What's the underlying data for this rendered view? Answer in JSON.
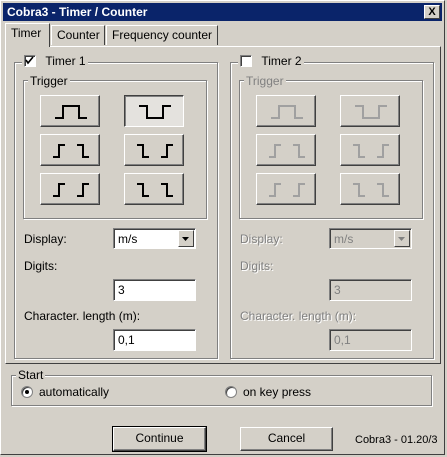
{
  "window": {
    "title": "Cobra3 - Timer / Counter",
    "close_label": "X"
  },
  "tabs": [
    {
      "label": "Timer"
    },
    {
      "label": "Counter"
    },
    {
      "label": "Frequency counter"
    }
  ],
  "timer1": {
    "label": "Timer 1",
    "checked": true,
    "trigger_title": "Trigger",
    "display_label": "Display:",
    "display_value": "m/s",
    "digits_label": "Digits:",
    "digits_value": "3",
    "charlen_label": "Character. length (m):",
    "charlen_value": "0,1"
  },
  "timer2": {
    "label": "Timer 2",
    "checked": false,
    "trigger_title": "Trigger",
    "display_label": "Display:",
    "display_value": "m/s",
    "digits_label": "Digits:",
    "digits_value": "3",
    "charlen_label": "Character. length (m):",
    "charlen_value": "0,1"
  },
  "trigger_buttons": [
    {
      "icon": "pulse-high-icon",
      "pressed": false
    },
    {
      "icon": "pulse-low-icon",
      "pressed": true
    },
    {
      "icon": "rising-falling-icon",
      "pressed": false
    },
    {
      "icon": "falling-rising-icon",
      "pressed": false
    },
    {
      "icon": "rising-rising-icon",
      "pressed": false
    },
    {
      "icon": "falling-falling-icon",
      "pressed": false
    }
  ],
  "start": {
    "title": "Start",
    "options": [
      {
        "label": "automatically",
        "selected": true
      },
      {
        "label": "on key press",
        "selected": false
      }
    ]
  },
  "buttons": {
    "continue": "Continue",
    "cancel": "Cancel"
  },
  "version": "Cobra3 - 01.20/3"
}
